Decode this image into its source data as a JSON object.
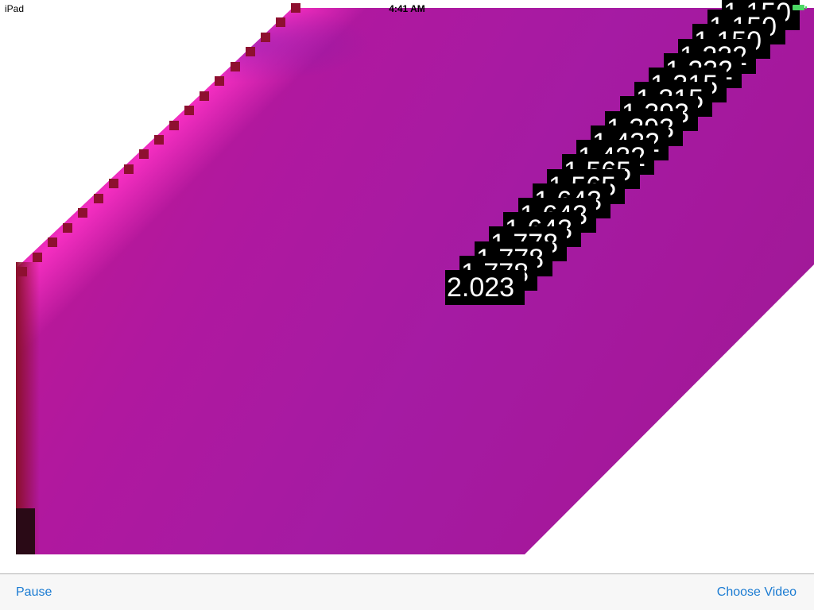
{
  "status_bar": {
    "carrier": "iPad",
    "time": "4:41 AM",
    "battery_color": "#4cd964"
  },
  "video": {
    "measurements": [
      "1.150",
      "1.150",
      "1.150",
      "1.232",
      "1.232",
      "1.315",
      "1.315",
      "1.393",
      "1.393",
      "1.432",
      "1.432",
      "1.565",
      "1.565",
      "1.643",
      "1.643",
      "1.643",
      "1.778",
      "1.778",
      "1.778",
      "2.023"
    ]
  },
  "toolbar": {
    "pause_label": "Pause",
    "choose_video_label": "Choose Video",
    "accent_color": "#1a7bd2"
  }
}
